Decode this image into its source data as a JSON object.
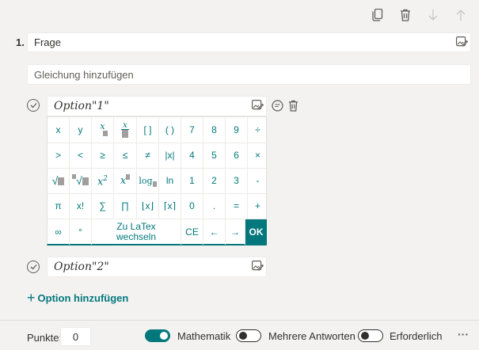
{
  "question": {
    "number": "1.",
    "title": "Frage",
    "equation_placeholder": "Gleichung hinzufügen"
  },
  "options": [
    {
      "text": "Option\"1\""
    },
    {
      "text": "Option\"2\""
    }
  ],
  "keyboard": {
    "rows": [
      [
        "x",
        "y",
        "x/□",
        "x/□",
        "[ ]",
        "( )",
        "7",
        "8",
        "9",
        "÷"
      ],
      [
        ">",
        "<",
        "≥",
        "≤",
        "≠",
        "|x|",
        "4",
        "5",
        "6",
        "×"
      ],
      [
        "√□",
        "□√□",
        "x²",
        "x□",
        "log□",
        "ln",
        "1",
        "2",
        "3",
        "-"
      ],
      [
        "π",
        "x!",
        "∑",
        "∏",
        "⌊x⌋",
        "⌈x⌉",
        "0",
        ".",
        "=",
        "+"
      ]
    ],
    "last_row": {
      "k1": "∞",
      "k2": "°",
      "latex_line1": "Zu LaTex",
      "latex_line2": "wechseln",
      "ce": "CE",
      "left": "←",
      "right": "→",
      "ok": "OK"
    }
  },
  "add_option": {
    "plus": "+",
    "label": "Option hinzufügen"
  },
  "footer": {
    "points_label": "Punkte:",
    "points_value": "0",
    "math_label": "Mathematik",
    "math_on": true,
    "multi_label": "Mehrere Antworten",
    "multi_on": false,
    "required_label": "Erforderlich",
    "required_on": false,
    "more": "···"
  },
  "colors": {
    "accent": "#03787c",
    "background": "#f3f2f1"
  }
}
